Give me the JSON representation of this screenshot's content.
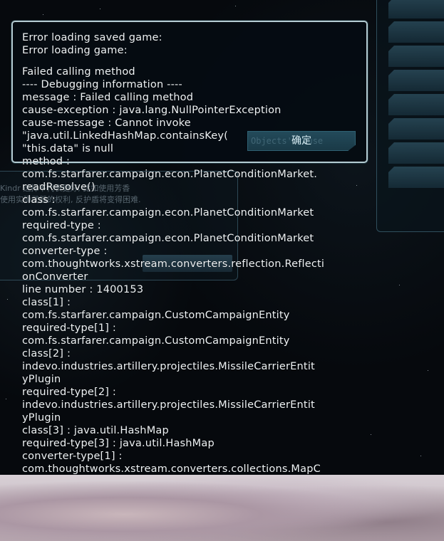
{
  "dialog": {
    "title_line1": "Error loading saved game:",
    "title_line2": "Error loading game:",
    "ok_label": "确定",
    "ok_ghost": "Objects' cause",
    "lines": [
      "Failed calling method",
      "---- Debugging information ----",
      "message            : Failed calling method",
      "cause-exception     : java.lang.NullPointerException",
      "cause-message       : Cannot invoke",
      "\"java.util.LinkedHashMap.containsKey(",
      "\"this.data\" is null",
      "method              :",
      "com.fs.starfarer.campaign.econ.PlanetConditionMarket.",
      "readResolve()",
      "class               :",
      "com.fs.starfarer.campaign.econ.PlanetConditionMarket",
      "required-type       :",
      "com.fs.starfarer.campaign.econ.PlanetConditionMarket",
      "converter-type      :",
      "com.thoughtworks.xstream.converters.reflection.Reflecti",
      "onConverter",
      "line number         : 1400153",
      "class[1]            :",
      "com.fs.starfarer.campaign.CustomCampaignEntity",
      "required-type[1]    :",
      "com.fs.starfarer.campaign.CustomCampaignEntity",
      "class[2]            :",
      "indevo.industries.artillery.projectiles.MissileCarrierEntit",
      "yPlugin",
      "required-type[2]    :",
      "indevo.industries.artillery.projectiles.MissileCarrierEntit",
      "yPlugin",
      "class[3]            : java.util.HashMap",
      "required-type[3]    : java.util.HashMap",
      "converter-type[1]   :",
      "com.thoughtworks.xstream.converters.collections.MapC"
    ]
  },
  "background": {
    "faded_text_1": "Kindr                选择不代表更好, 比如使用芳香",
    "faded_text_2": "使用实弹武器的权利, 反护盾将变得困难."
  },
  "colors": {
    "dialog_border": "#b4cbd2",
    "text": "#eef2f4",
    "button_fill": "#234a5a"
  }
}
